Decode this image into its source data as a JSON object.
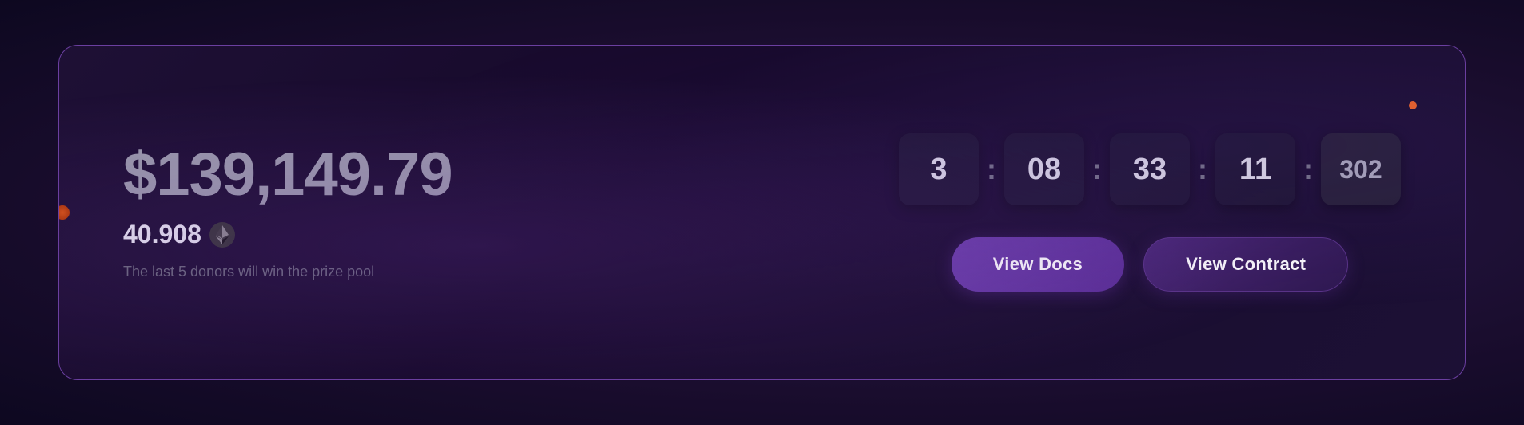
{
  "card": {
    "price_usd": "$139,149.79",
    "price_eth": "40.908",
    "eth_symbol": "Ξ",
    "description": "The last 5 donors will win the prize pool",
    "timer": {
      "days": "3",
      "hours": "08",
      "minutes": "33",
      "seconds": "11",
      "milliseconds": "302",
      "separator": ":"
    },
    "buttons": {
      "view_docs": "View Docs",
      "view_contract": "View Contract"
    }
  }
}
